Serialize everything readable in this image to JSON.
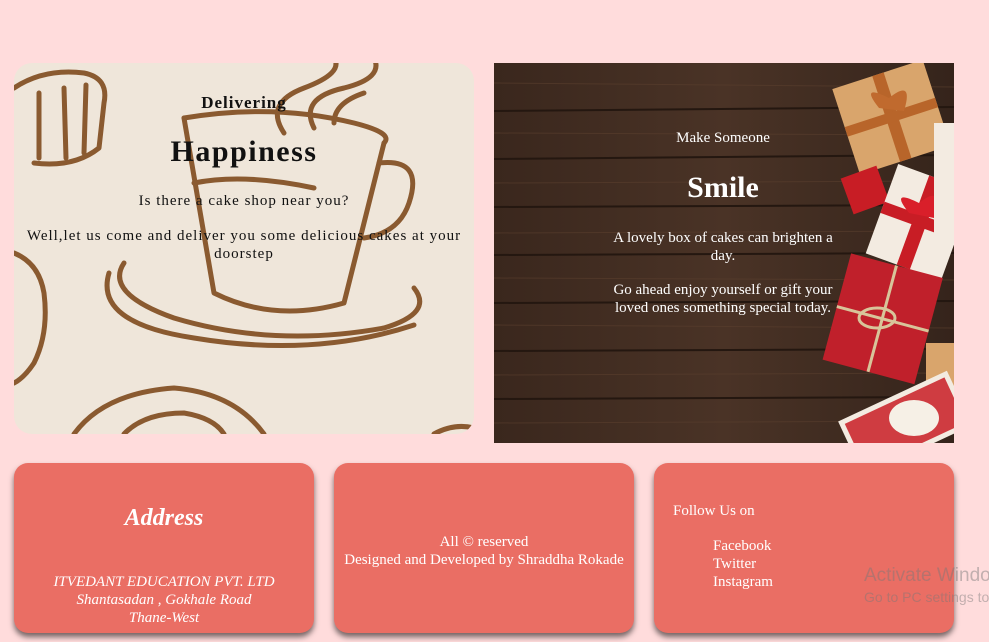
{
  "colors": {
    "page_bg": "#ffdcdc",
    "footer_box": "#ea6e64",
    "left_card_bg": "#efe6da",
    "sketch": "#8a5a30",
    "wood": "#3e2a1f"
  },
  "left_card": {
    "small_title": "Delivering",
    "big_title": "Happiness",
    "question": "Is there a cake shop near you?",
    "description": "Well,let us come and deliver you some delicious cakes at your doorstep"
  },
  "right_card": {
    "small_title": "Make Someone",
    "big_title": "Smile",
    "para1": "A lovely box of cakes can brighten a day.",
    "para2": "Go ahead enjoy yourself or gift your loved ones something special today."
  },
  "footer": {
    "address": {
      "title": "Address",
      "lines": [
        "ITVEDANT EDUCATION PVT. LTD",
        "Shantasadan , Gokhale Road",
        "Thane-West"
      ]
    },
    "middle": {
      "line1": "All © reserved",
      "line2": "Designed and Developed by Shraddha Rokade"
    },
    "follow": {
      "title": "Follow Us on",
      "links": [
        "Facebook",
        "Twitter",
        "Instagram"
      ]
    }
  },
  "watermark": {
    "line1": "Activate Windows",
    "line2": "Go to PC settings to activate Windows."
  }
}
